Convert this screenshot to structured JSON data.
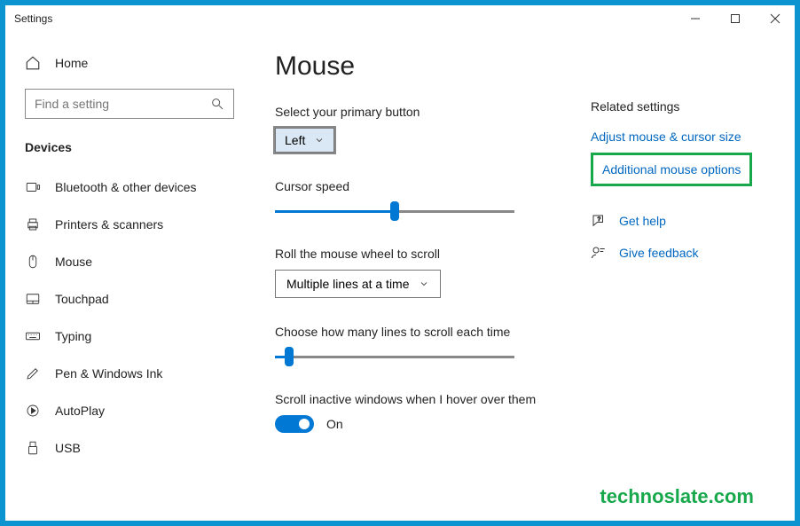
{
  "window": {
    "title": "Settings"
  },
  "sidebar": {
    "home_label": "Home",
    "search_placeholder": "Find a setting",
    "category": "Devices",
    "items": [
      {
        "label": "Bluetooth & other devices"
      },
      {
        "label": "Printers & scanners"
      },
      {
        "label": "Mouse"
      },
      {
        "label": "Touchpad"
      },
      {
        "label": "Typing"
      },
      {
        "label": "Pen & Windows Ink"
      },
      {
        "label": "AutoPlay"
      },
      {
        "label": "USB"
      }
    ]
  },
  "main": {
    "title": "Mouse",
    "primary_button": {
      "label": "Select your primary button",
      "value": "Left"
    },
    "cursor_speed": {
      "label": "Cursor speed",
      "value_pct": 48
    },
    "wheel_mode": {
      "label": "Roll the mouse wheel to scroll",
      "value": "Multiple lines at a time"
    },
    "lines_scroll": {
      "label": "Choose how many lines to scroll each time",
      "value_pct": 4
    },
    "inactive_hover": {
      "label": "Scroll inactive windows when I hover over them",
      "state": "On"
    }
  },
  "related": {
    "heading": "Related settings",
    "link_cursor_size": "Adjust mouse & cursor size",
    "link_additional": "Additional mouse options",
    "get_help": "Get help",
    "give_feedback": "Give feedback"
  },
  "watermark": "technoslate.com"
}
